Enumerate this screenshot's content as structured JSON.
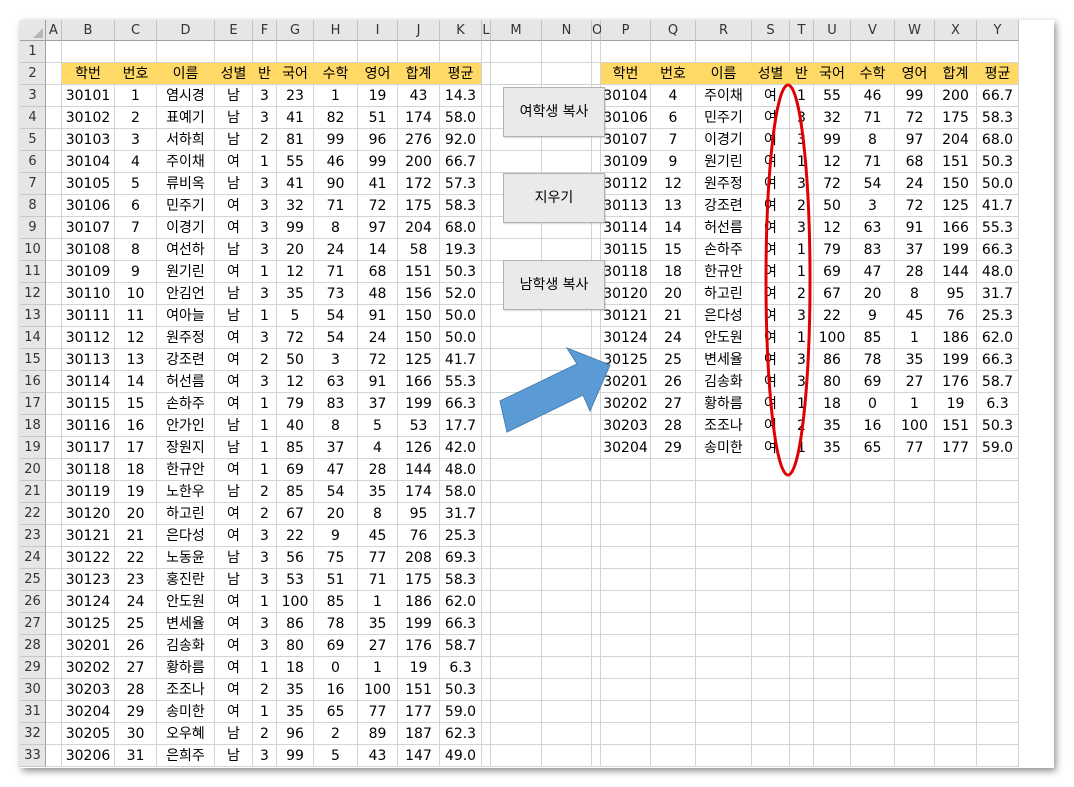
{
  "columns": [
    "A",
    "B",
    "C",
    "D",
    "E",
    "F",
    "G",
    "H",
    "I",
    "J",
    "K",
    "L",
    "M",
    "N",
    "O",
    "P",
    "Q",
    "R",
    "S",
    "T",
    "U",
    "V",
    "W",
    "X",
    "Y"
  ],
  "rows": [
    "1",
    "2",
    "3",
    "4",
    "5",
    "6",
    "7",
    "8",
    "9",
    "10",
    "11",
    "12",
    "13",
    "14",
    "15",
    "16",
    "17",
    "18",
    "19",
    "20",
    "21",
    "22",
    "23",
    "24",
    "25",
    "26",
    "27",
    "28",
    "29",
    "30",
    "31",
    "32",
    "33"
  ],
  "headers": [
    "학번",
    "번호",
    "이름",
    "성별",
    "반",
    "국어",
    "수학",
    "영어",
    "합계",
    "평균"
  ],
  "source_rows": [
    [
      "30101",
      "1",
      "염시경",
      "남",
      "3",
      "23",
      "1",
      "19",
      "43",
      "14.3"
    ],
    [
      "30102",
      "2",
      "표예기",
      "남",
      "3",
      "41",
      "82",
      "51",
      "174",
      "58.0"
    ],
    [
      "30103",
      "3",
      "서하희",
      "남",
      "2",
      "81",
      "99",
      "96",
      "276",
      "92.0"
    ],
    [
      "30104",
      "4",
      "주이채",
      "여",
      "1",
      "55",
      "46",
      "99",
      "200",
      "66.7"
    ],
    [
      "30105",
      "5",
      "류비옥",
      "남",
      "3",
      "41",
      "90",
      "41",
      "172",
      "57.3"
    ],
    [
      "30106",
      "6",
      "민주기",
      "여",
      "3",
      "32",
      "71",
      "72",
      "175",
      "58.3"
    ],
    [
      "30107",
      "7",
      "이경기",
      "여",
      "3",
      "99",
      "8",
      "97",
      "204",
      "68.0"
    ],
    [
      "30108",
      "8",
      "여선하",
      "남",
      "3",
      "20",
      "24",
      "14",
      "58",
      "19.3"
    ],
    [
      "30109",
      "9",
      "원기린",
      "여",
      "1",
      "12",
      "71",
      "68",
      "151",
      "50.3"
    ],
    [
      "30110",
      "10",
      "안김언",
      "남",
      "3",
      "35",
      "73",
      "48",
      "156",
      "52.0"
    ],
    [
      "30111",
      "11",
      "여아늘",
      "남",
      "1",
      "5",
      "54",
      "91",
      "150",
      "50.0"
    ],
    [
      "30112",
      "12",
      "원주정",
      "여",
      "3",
      "72",
      "54",
      "24",
      "150",
      "50.0"
    ],
    [
      "30113",
      "13",
      "강조련",
      "여",
      "2",
      "50",
      "3",
      "72",
      "125",
      "41.7"
    ],
    [
      "30114",
      "14",
      "허선름",
      "여",
      "3",
      "12",
      "63",
      "91",
      "166",
      "55.3"
    ],
    [
      "30115",
      "15",
      "손하주",
      "여",
      "1",
      "79",
      "83",
      "37",
      "199",
      "66.3"
    ],
    [
      "30116",
      "16",
      "안가인",
      "남",
      "1",
      "40",
      "8",
      "5",
      "53",
      "17.7"
    ],
    [
      "30117",
      "17",
      "장원지",
      "남",
      "1",
      "85",
      "37",
      "4",
      "126",
      "42.0"
    ],
    [
      "30118",
      "18",
      "한규안",
      "여",
      "1",
      "69",
      "47",
      "28",
      "144",
      "48.0"
    ],
    [
      "30119",
      "19",
      "노한우",
      "남",
      "2",
      "85",
      "54",
      "35",
      "174",
      "58.0"
    ],
    [
      "30120",
      "20",
      "하고린",
      "여",
      "2",
      "67",
      "20",
      "8",
      "95",
      "31.7"
    ],
    [
      "30121",
      "21",
      "은다성",
      "여",
      "3",
      "22",
      "9",
      "45",
      "76",
      "25.3"
    ],
    [
      "30122",
      "22",
      "노동윤",
      "남",
      "3",
      "56",
      "75",
      "77",
      "208",
      "69.3"
    ],
    [
      "30123",
      "23",
      "홍진란",
      "남",
      "3",
      "53",
      "51",
      "71",
      "175",
      "58.3"
    ],
    [
      "30124",
      "24",
      "안도원",
      "여",
      "1",
      "100",
      "85",
      "1",
      "186",
      "62.0"
    ],
    [
      "30125",
      "25",
      "변세율",
      "여",
      "3",
      "86",
      "78",
      "35",
      "199",
      "66.3"
    ],
    [
      "30201",
      "26",
      "김송화",
      "여",
      "3",
      "80",
      "69",
      "27",
      "176",
      "58.7"
    ],
    [
      "30202",
      "27",
      "황하름",
      "여",
      "1",
      "18",
      "0",
      "1",
      "19",
      "6.3"
    ],
    [
      "30203",
      "28",
      "조조나",
      "여",
      "2",
      "35",
      "16",
      "100",
      "151",
      "50.3"
    ],
    [
      "30204",
      "29",
      "송미한",
      "여",
      "1",
      "35",
      "65",
      "77",
      "177",
      "59.0"
    ],
    [
      "30205",
      "30",
      "오우혜",
      "남",
      "2",
      "96",
      "2",
      "89",
      "187",
      "62.3"
    ],
    [
      "30206",
      "31",
      "은희주",
      "남",
      "3",
      "99",
      "5",
      "43",
      "147",
      "49.0"
    ]
  ],
  "result_rows": [
    [
      "30104",
      "4",
      "주이채",
      "여",
      "1",
      "55",
      "46",
      "99",
      "200",
      "66.7"
    ],
    [
      "30106",
      "6",
      "민주기",
      "여",
      "3",
      "32",
      "71",
      "72",
      "175",
      "58.3"
    ],
    [
      "30107",
      "7",
      "이경기",
      "여",
      "3",
      "99",
      "8",
      "97",
      "204",
      "68.0"
    ],
    [
      "30109",
      "9",
      "원기린",
      "여",
      "1",
      "12",
      "71",
      "68",
      "151",
      "50.3"
    ],
    [
      "30112",
      "12",
      "원주정",
      "여",
      "3",
      "72",
      "54",
      "24",
      "150",
      "50.0"
    ],
    [
      "30113",
      "13",
      "강조련",
      "여",
      "2",
      "50",
      "3",
      "72",
      "125",
      "41.7"
    ],
    [
      "30114",
      "14",
      "허선름",
      "여",
      "3",
      "12",
      "63",
      "91",
      "166",
      "55.3"
    ],
    [
      "30115",
      "15",
      "손하주",
      "여",
      "1",
      "79",
      "83",
      "37",
      "199",
      "66.3"
    ],
    [
      "30118",
      "18",
      "한규안",
      "여",
      "1",
      "69",
      "47",
      "28",
      "144",
      "48.0"
    ],
    [
      "30120",
      "20",
      "하고린",
      "여",
      "2",
      "67",
      "20",
      "8",
      "95",
      "31.7"
    ],
    [
      "30121",
      "21",
      "은다성",
      "여",
      "3",
      "22",
      "9",
      "45",
      "76",
      "25.3"
    ],
    [
      "30124",
      "24",
      "안도원",
      "여",
      "1",
      "100",
      "85",
      "1",
      "186",
      "62.0"
    ],
    [
      "30125",
      "25",
      "변세율",
      "여",
      "3",
      "86",
      "78",
      "35",
      "199",
      "66.3"
    ],
    [
      "30201",
      "26",
      "김송화",
      "여",
      "3",
      "80",
      "69",
      "27",
      "176",
      "58.7"
    ],
    [
      "30202",
      "27",
      "황하름",
      "여",
      "1",
      "18",
      "0",
      "1",
      "19",
      "6.3"
    ],
    [
      "30203",
      "28",
      "조조나",
      "여",
      "2",
      "35",
      "16",
      "100",
      "151",
      "50.3"
    ],
    [
      "30204",
      "29",
      "송미한",
      "여",
      "1",
      "35",
      "65",
      "77",
      "177",
      "59.0"
    ]
  ],
  "buttons": {
    "copy_female": "여학생 복사",
    "clear": "지우기",
    "copy_male": "남학생 복사"
  },
  "colors": {
    "header_fill": "#ffd966",
    "arrow_fill": "#5b9bd5",
    "highlight_ellipse": "#e00000"
  },
  "annotations": {
    "arrow": "arrow-right-icon",
    "ellipse": "highlight-ellipse"
  }
}
